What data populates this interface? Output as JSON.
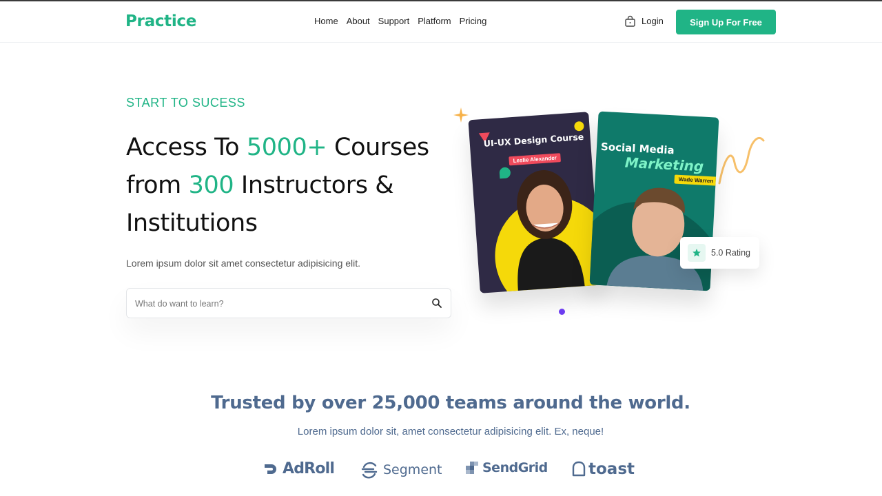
{
  "header": {
    "logo": "Practice",
    "nav": [
      "Home",
      "About",
      "Support",
      "Platform",
      "Pricing"
    ],
    "login_label": "Login",
    "signup_label": "Sign Up For Free"
  },
  "hero": {
    "eyebrow": "START TO SUCESS",
    "headline": {
      "part1": "Access To ",
      "accent1": "5000+",
      "part2": " Courses from ",
      "accent2": "300",
      "part3": " Instructors & Institutions"
    },
    "subtext": "Lorem ipsum dolor sit amet consectetur adipisicing elit.",
    "search": {
      "placeholder": "What do want to learn?",
      "value": ""
    }
  },
  "cards": [
    {
      "title": "UI-UX Design Course",
      "instructor": "Leslie Alexander"
    },
    {
      "title_line1": "Social Media",
      "title_line2": "Marketing",
      "instructor": "Wade Warren"
    }
  ],
  "rating": {
    "label": "5.0 Rating"
  },
  "trusted": {
    "title": "Trusted by over 25,000 teams around the world.",
    "subtitle": "Lorem ipsum dolor sit, amet consectetur adipisicing elit. Ex, neque!",
    "logos": [
      "AdRoll",
      "Segment",
      "SendGrid",
      "toast"
    ]
  },
  "colors": {
    "brand": "#20b486",
    "accent_purple": "#6c3cf0",
    "trusted_text": "#4f6a8f"
  }
}
